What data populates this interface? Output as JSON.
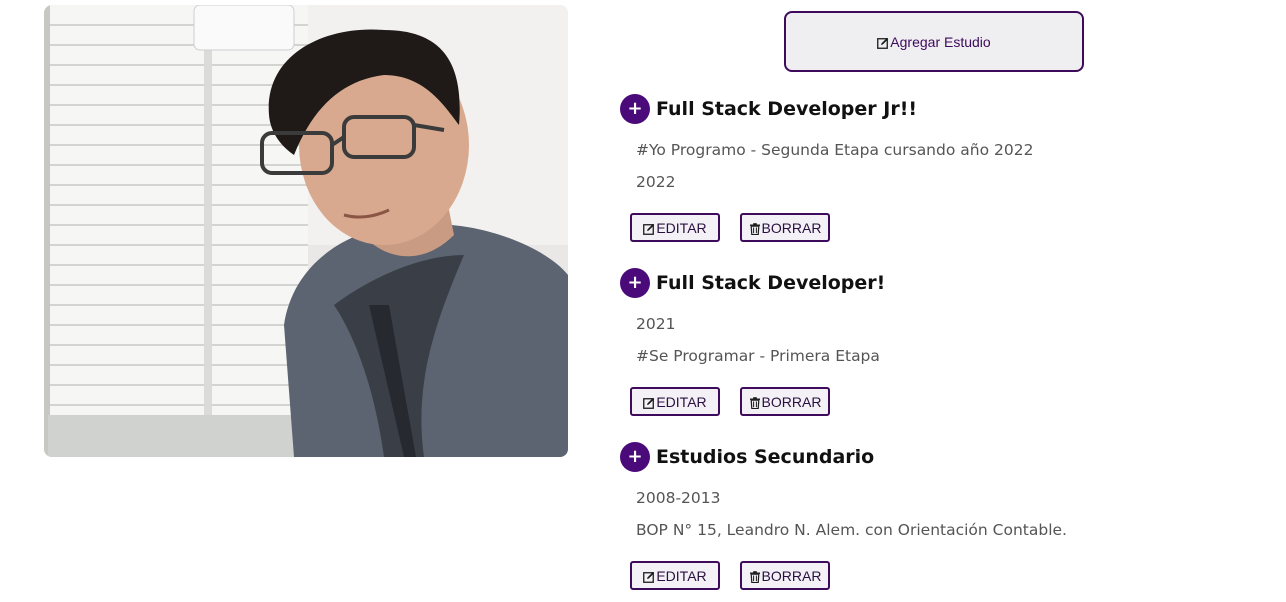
{
  "profile_photo": {
    "alt": "Foto de perfil"
  },
  "add_study": {
    "label": "Agregar Estudio",
    "icon": "pencil-square-icon"
  },
  "colors": {
    "accent": "#4b0a7a",
    "button_border": "#3d0a5c",
    "text_muted": "#555555",
    "title": "#111111"
  },
  "studies": [
    {
      "title": "Full Stack Developer Jr!!",
      "line1": "#Yo Programo - Segunda Etapa cursando año 2022",
      "line2": "2022",
      "edit_label": "EDITAR",
      "delete_label": "BORRAR"
    },
    {
      "title": "Full Stack Developer!",
      "line1": "2021",
      "line2": "#Se Programar - Primera Etapa",
      "edit_label": "EDITAR",
      "delete_label": "BORRAR"
    },
    {
      "title": "Estudios Secundario",
      "line1": "2008-2013",
      "line2": "BOP N° 15, Leandro N. Alem. con Orientación Contable.",
      "edit_label": "EDITAR",
      "delete_label": "BORRAR"
    }
  ],
  "plus_symbol": "+"
}
